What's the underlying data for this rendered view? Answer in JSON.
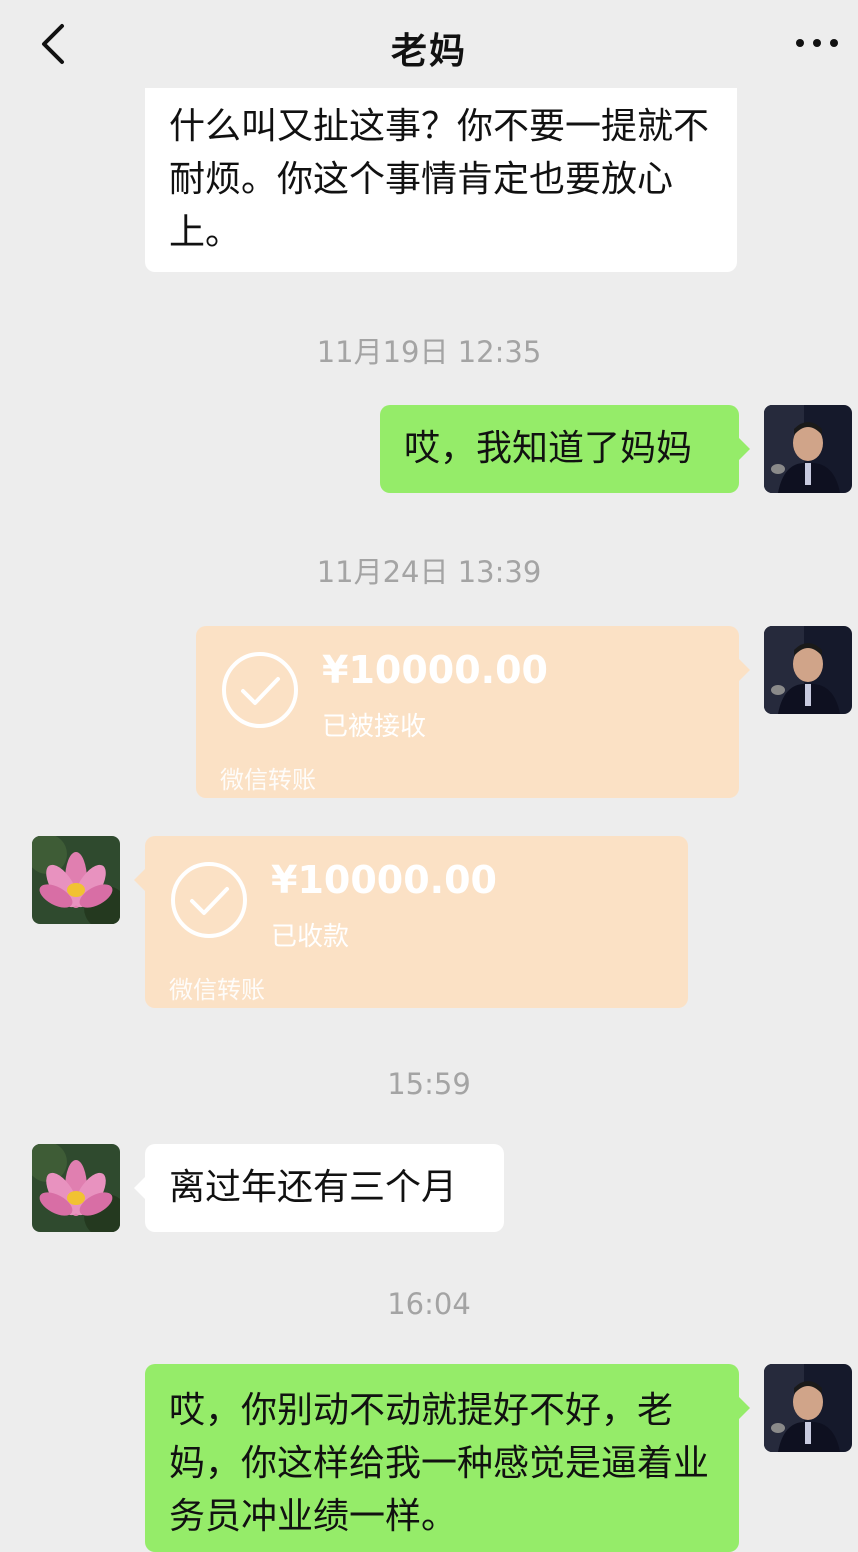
{
  "header": {
    "back_icon": "chevron-left-icon",
    "title": "老妈",
    "more_icon": "more-dots-icon"
  },
  "messages": [
    {
      "type": "text",
      "from": "mom",
      "text": "什么叫又扯这事？你不要一提就不耐烦。你这个事情肯定也要放心上。"
    },
    {
      "type": "time",
      "text": "11月19日 12:35"
    },
    {
      "type": "text",
      "from": "me",
      "text": "哎，我知道了妈妈"
    },
    {
      "type": "time",
      "text": "11月24日 13:39"
    },
    {
      "type": "transfer",
      "from": "me",
      "amount": "¥10000.00",
      "status": "已被接收",
      "label": "微信转账"
    },
    {
      "type": "transfer",
      "from": "mom",
      "amount": "¥10000.00",
      "status": "已收款",
      "label": "微信转账"
    },
    {
      "type": "time",
      "text": "15:59"
    },
    {
      "type": "text",
      "from": "mom",
      "text": "离过年还有三个月"
    },
    {
      "type": "time",
      "text": "16:04"
    },
    {
      "type": "text",
      "from": "me",
      "text": "哎，你别动不动就提好不好，老妈，你这样给我一种感觉是逼着业务员冲业绩一样。"
    }
  ],
  "colors": {
    "background": "#ededed",
    "my_bubble": "#95ec69",
    "their_bubble": "#ffffff",
    "transfer": "#fbe1c5",
    "timestamp": "#a4a4a4"
  }
}
